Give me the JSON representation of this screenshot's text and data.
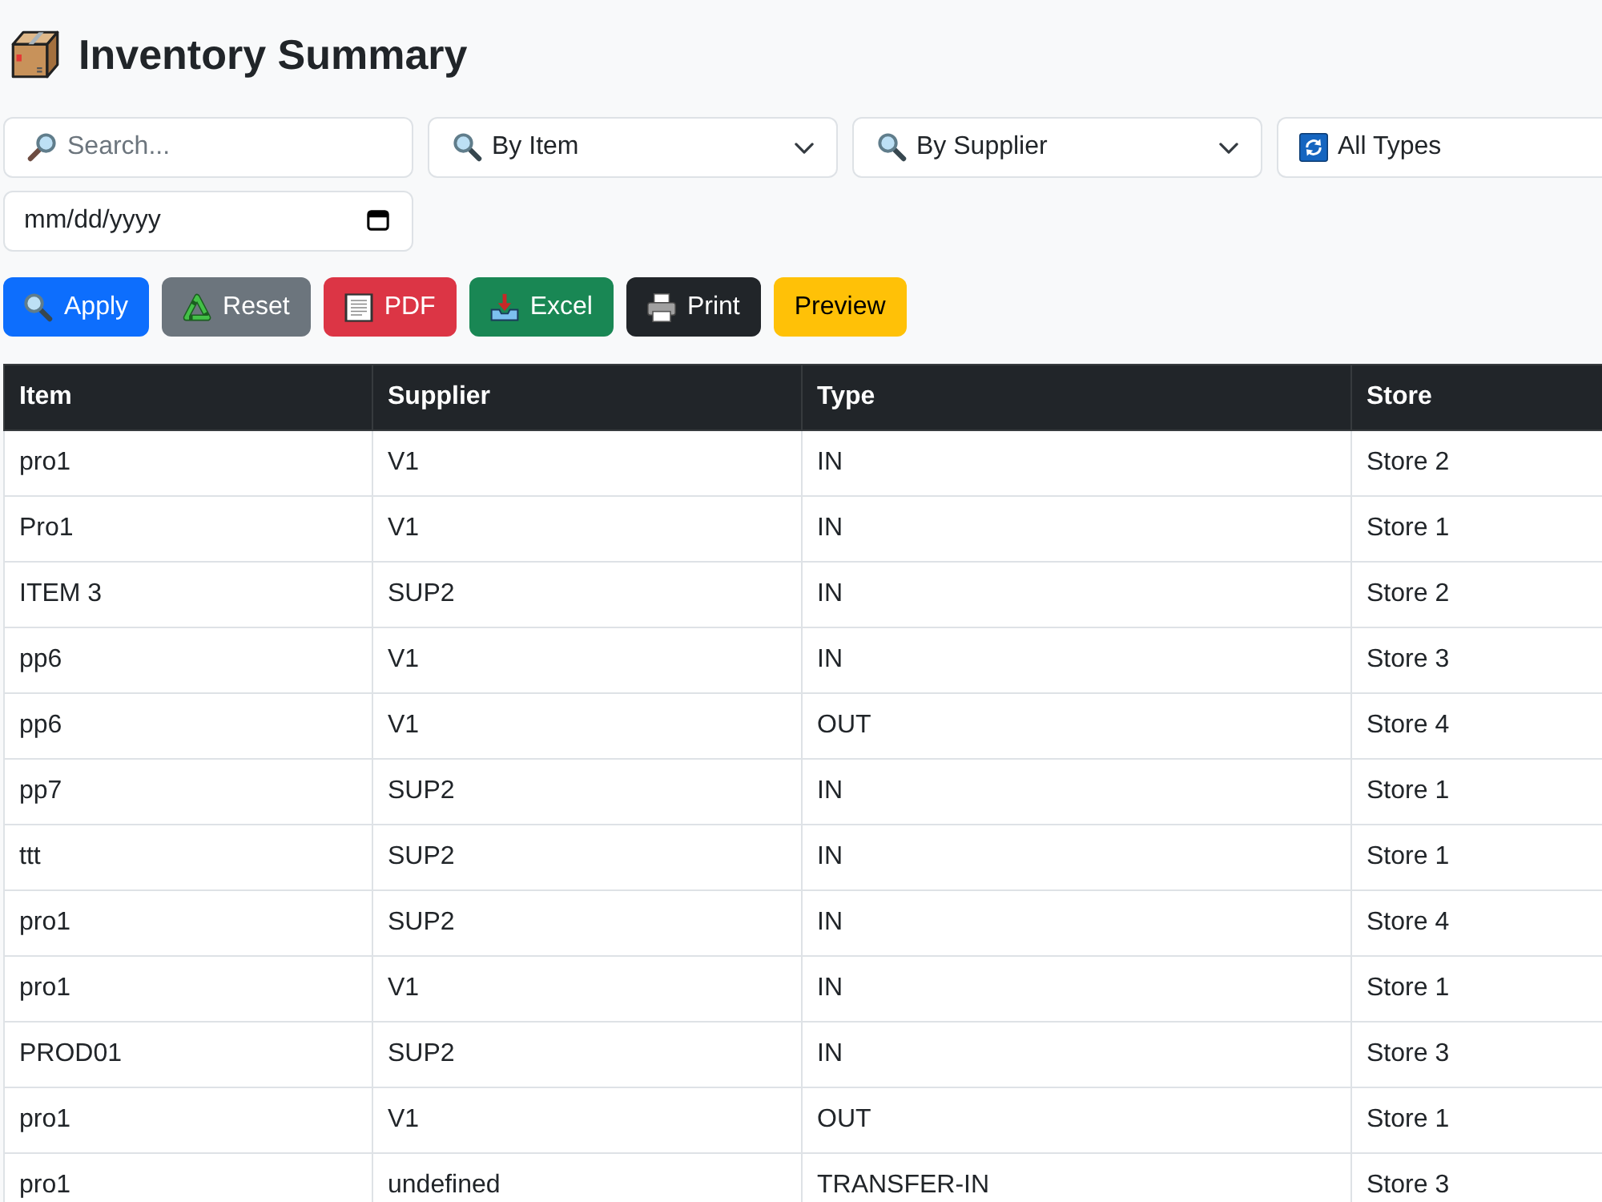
{
  "title": "Inventory Summary",
  "filters": [
    {
      "kind": "search",
      "placeholder": "Search..."
    },
    {
      "kind": "select",
      "value": "By Item",
      "caret": true
    },
    {
      "kind": "select",
      "value": "By Supplier",
      "caret": true
    },
    {
      "kind": "select",
      "value": "All Types",
      "caret": false
    },
    {
      "kind": "date",
      "placeholder": "mm/dd/yyyy"
    }
  ],
  "buttons": [
    {
      "label": "Apply",
      "color": "#0d6efd"
    },
    {
      "label": "Reset",
      "color": "#6c757d"
    },
    {
      "label": "PDF",
      "color": "#dc3545"
    },
    {
      "label": "Excel",
      "color": "#198754"
    },
    {
      "label": "Print",
      "color": "#212529"
    },
    {
      "label": "Preview",
      "color": "#ffc107"
    }
  ],
  "table": {
    "columns": [
      "Item",
      "Supplier",
      "Type",
      "Store"
    ],
    "rows": [
      [
        "pro1",
        "V1",
        "IN",
        "Store 2"
      ],
      [
        "Pro1",
        "V1",
        "IN",
        "Store 1"
      ],
      [
        "ITEM 3",
        "SUP2",
        "IN",
        "Store 2"
      ],
      [
        "pp6",
        "V1",
        "IN",
        "Store 3"
      ],
      [
        "pp6",
        "V1",
        "OUT",
        "Store 4"
      ],
      [
        "pp7",
        "SUP2",
        "IN",
        "Store 1"
      ],
      [
        "ttt",
        "SUP2",
        "IN",
        "Store 1"
      ],
      [
        "pro1",
        "SUP2",
        "IN",
        "Store 4"
      ],
      [
        "pro1",
        "V1",
        "IN",
        "Store 1"
      ],
      [
        "PROD01",
        "SUP2",
        "IN",
        "Store 3"
      ],
      [
        "pro1",
        "V1",
        "OUT",
        "Store 1"
      ],
      [
        "pro1",
        "undefined",
        "TRANSFER-IN",
        "Store 3"
      ]
    ]
  }
}
